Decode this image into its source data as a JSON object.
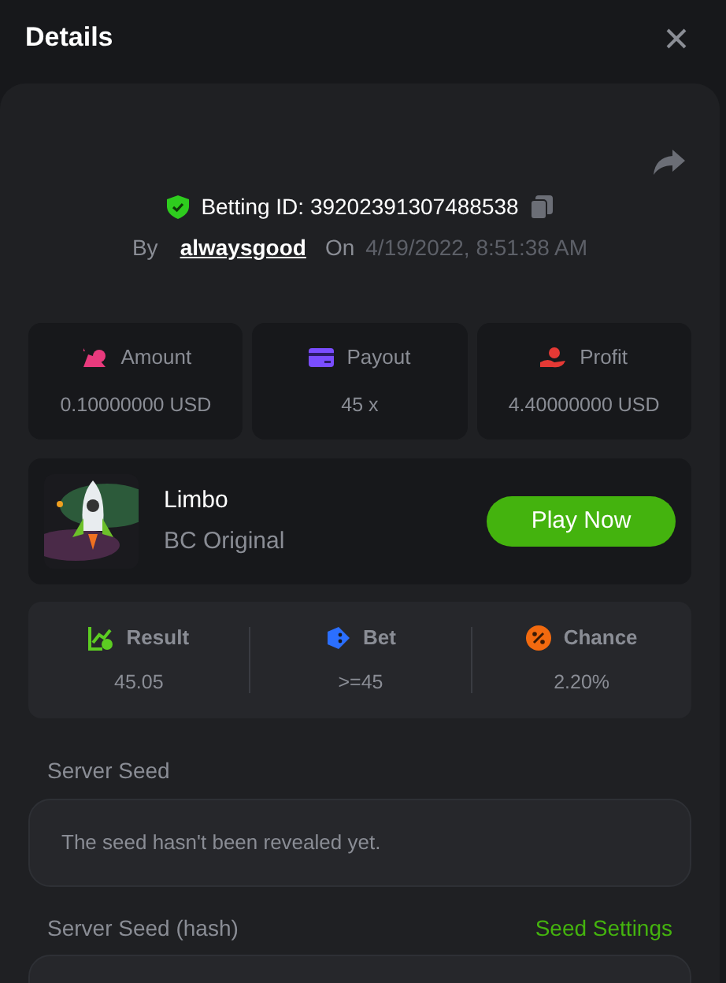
{
  "title": "Details",
  "bet": {
    "id_label": "Betting ID: 39202391307488538",
    "by_label": "By",
    "user": "alwaysgood",
    "on_label": "On",
    "date": "4/19/2022, 8:51:38 AM"
  },
  "stats": [
    {
      "label": "Amount",
      "value": "0.10000000 USD"
    },
    {
      "label": "Payout",
      "value": "45 x"
    },
    {
      "label": "Profit",
      "value": "4.40000000 USD"
    }
  ],
  "game": {
    "name": "Limbo",
    "provider": "BC Original",
    "button": "Play Now"
  },
  "results": [
    {
      "label": "Result",
      "value": "45.05"
    },
    {
      "label": "Bet",
      "value": ">=45"
    },
    {
      "label": "Chance",
      "value": "2.20%"
    }
  ],
  "server_seed": {
    "label": "Server Seed",
    "value": "The seed hasn't been revealed yet."
  },
  "server_seed_hash": {
    "label": "Server Seed (hash)",
    "link": "Seed Settings"
  }
}
